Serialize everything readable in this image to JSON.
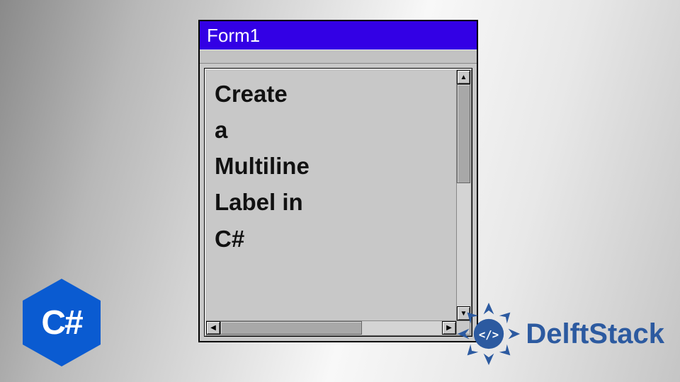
{
  "window": {
    "title": "Form1"
  },
  "label": {
    "lines": [
      "Create",
      "a",
      "Multiline",
      "Label in",
      "C#"
    ]
  },
  "badges": {
    "csharp": "C#",
    "brand": "DelftStack",
    "brand_tag": "</>"
  },
  "colors": {
    "titlebar": "#3300e5",
    "csharp_hex": "#0a5bd1",
    "brand_blue": "#2c5aa0"
  }
}
